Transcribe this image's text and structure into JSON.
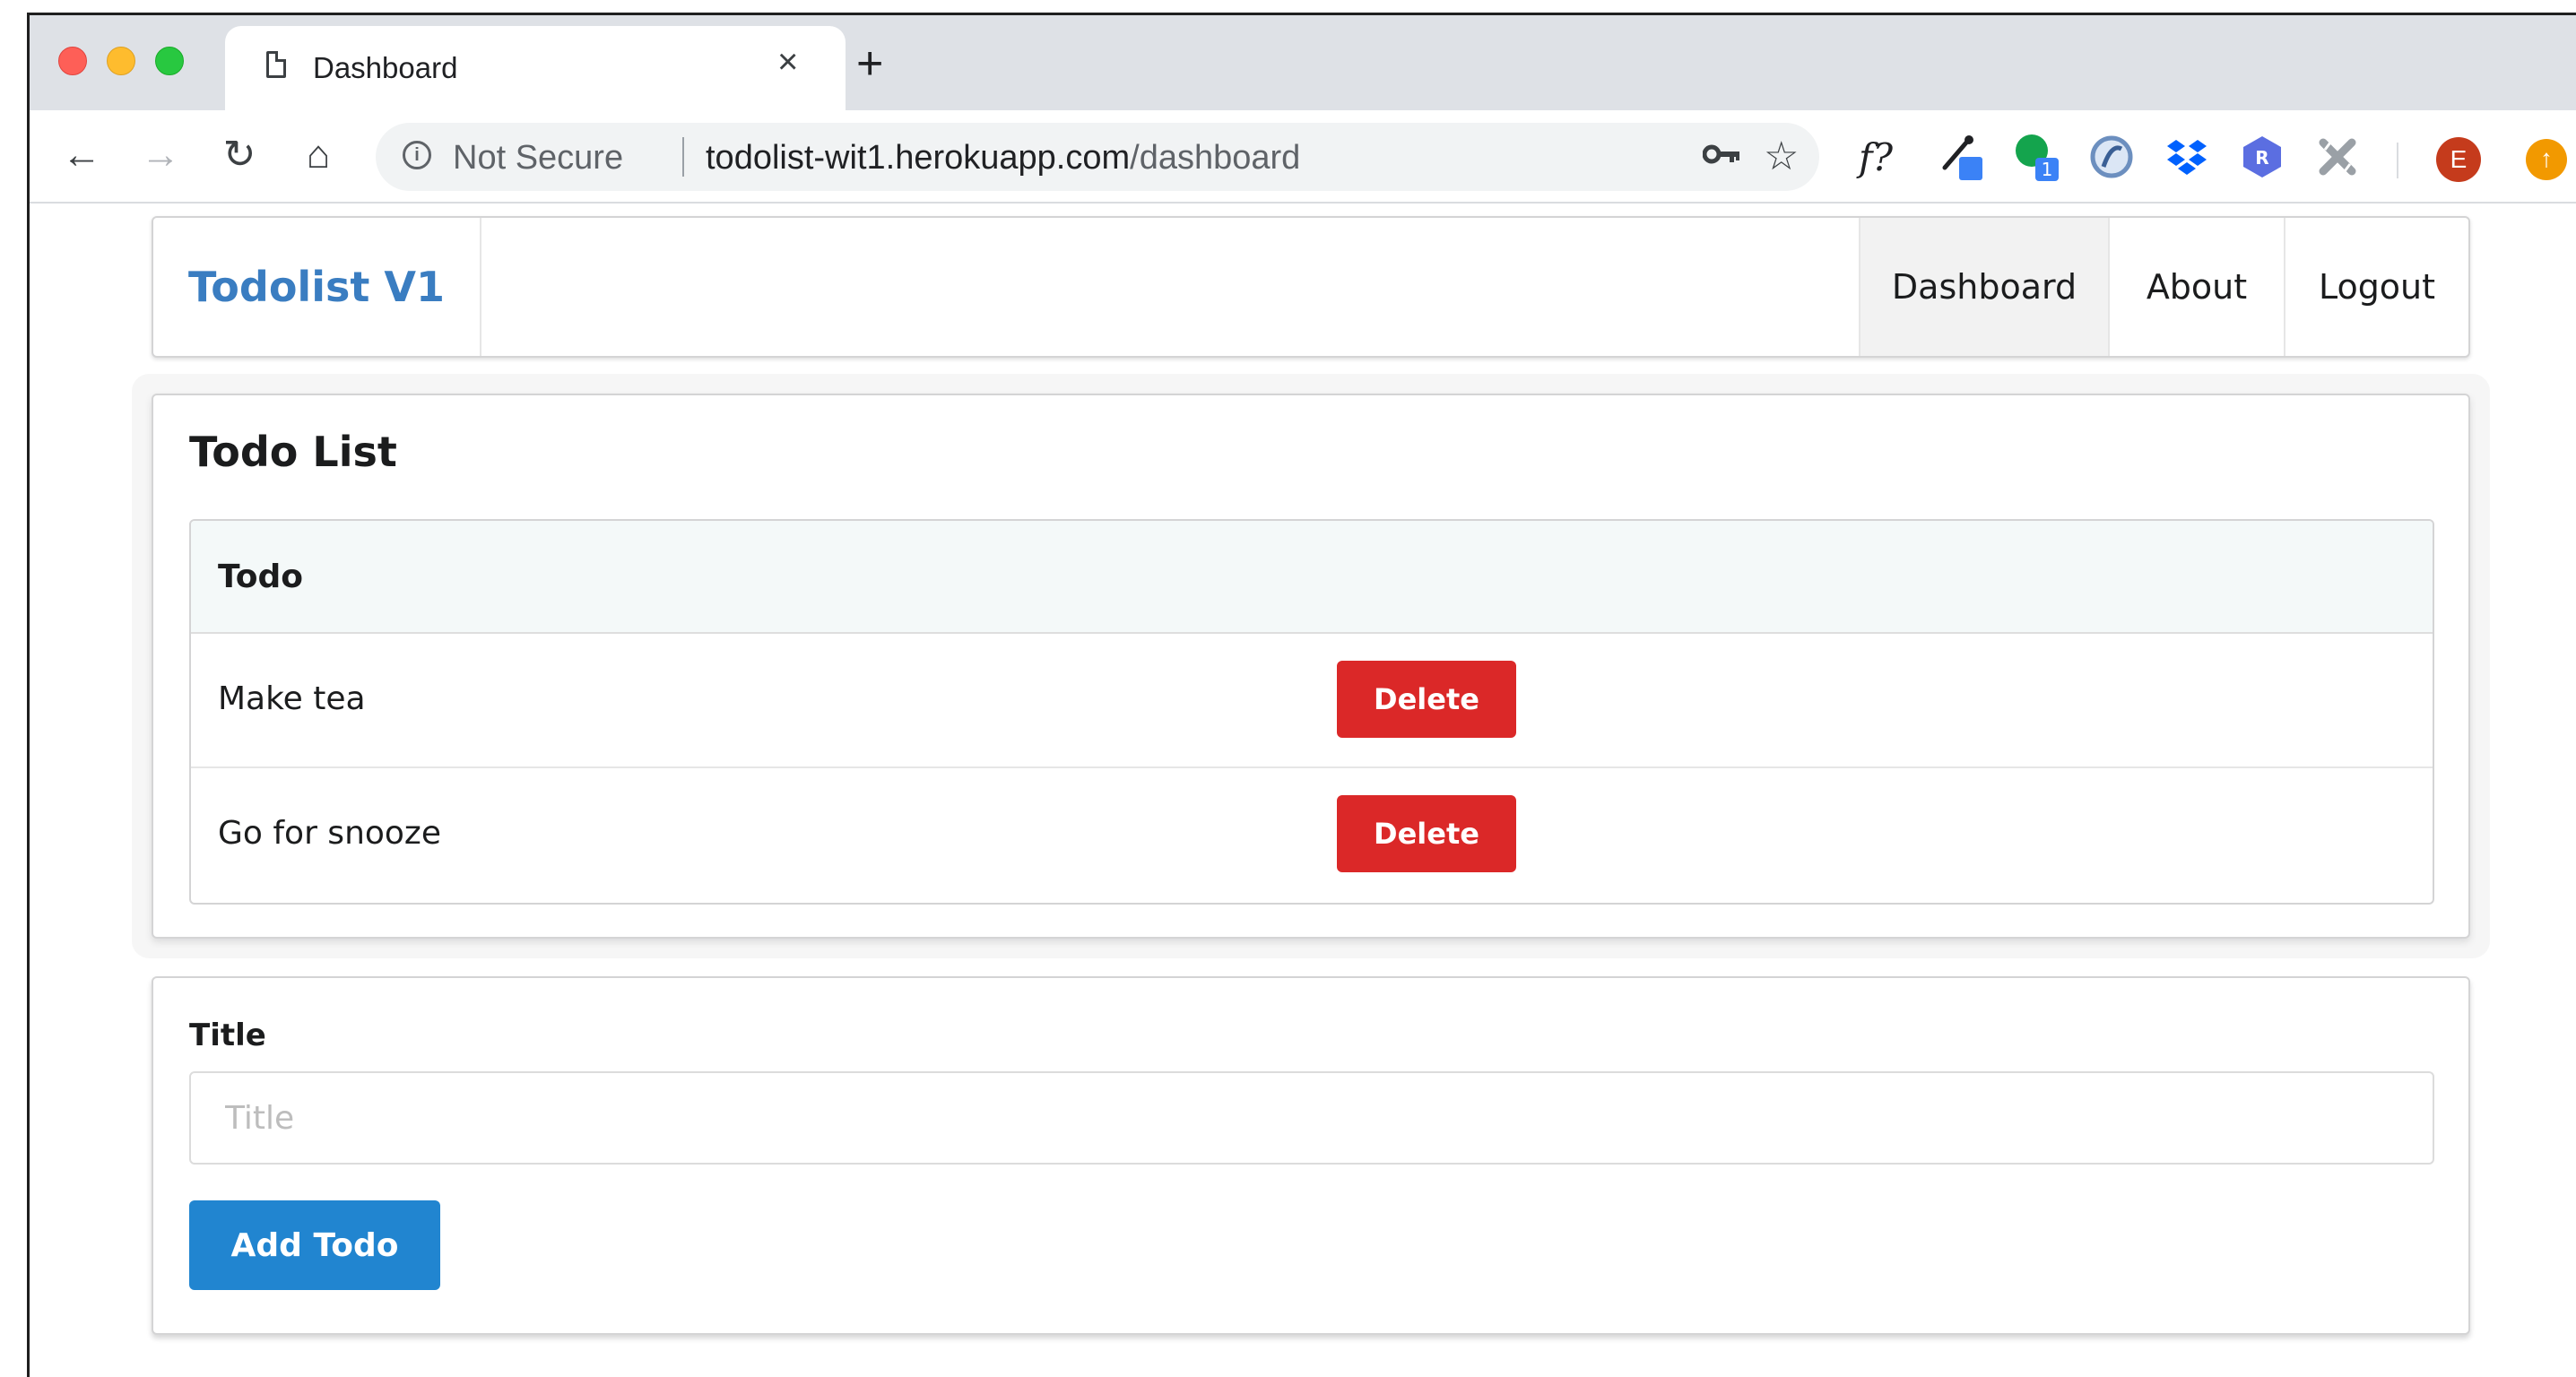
{
  "browser": {
    "tab": {
      "title": "Dashboard",
      "close_glyph": "×"
    },
    "new_tab_glyph": "+",
    "nav": {
      "back_glyph": "←",
      "forward_glyph": "→",
      "reload_glyph": "↻",
      "home_glyph": "⌂"
    },
    "omnibox": {
      "security_label": "Not Secure",
      "url_host": "todolist-wit1.herokuapp.com",
      "url_path": "/dashboard"
    },
    "extensions": {
      "formula_label": "f?",
      "profile_initial": "E"
    },
    "colors": {
      "tab_strip": "#dee1e6",
      "profile_avatar": "#c53b1c",
      "update_badge": "#f29900"
    },
    "icons": [
      "document-icon",
      "close-icon",
      "plus-icon",
      "back-icon",
      "forward-icon",
      "reload-icon",
      "home-icon",
      "info-icon",
      "key-icon",
      "star-icon",
      "eyedropper-icon",
      "green-dot-icon",
      "blue-circle-icon",
      "dropbox-icon",
      "r-badge-icon",
      "tools-icon",
      "update-icon"
    ]
  },
  "app": {
    "brand": "Todolist V1",
    "brand_color": "#3a7dc1",
    "nav_items": [
      {
        "label": "Dashboard",
        "active": true
      },
      {
        "label": "About",
        "active": false
      },
      {
        "label": "Logout",
        "active": false
      }
    ],
    "todo_card": {
      "title": "Todo List",
      "column_header": "Todo",
      "items": [
        {
          "text": "Make tea",
          "action_label": "Delete"
        },
        {
          "text": "Go for snooze",
          "action_label": "Delete"
        }
      ],
      "delete_color": "#db2828"
    },
    "form": {
      "field_label": "Title",
      "placeholder": "Title",
      "value": "",
      "submit_label": "Add Todo",
      "submit_color": "#2185d0"
    }
  }
}
